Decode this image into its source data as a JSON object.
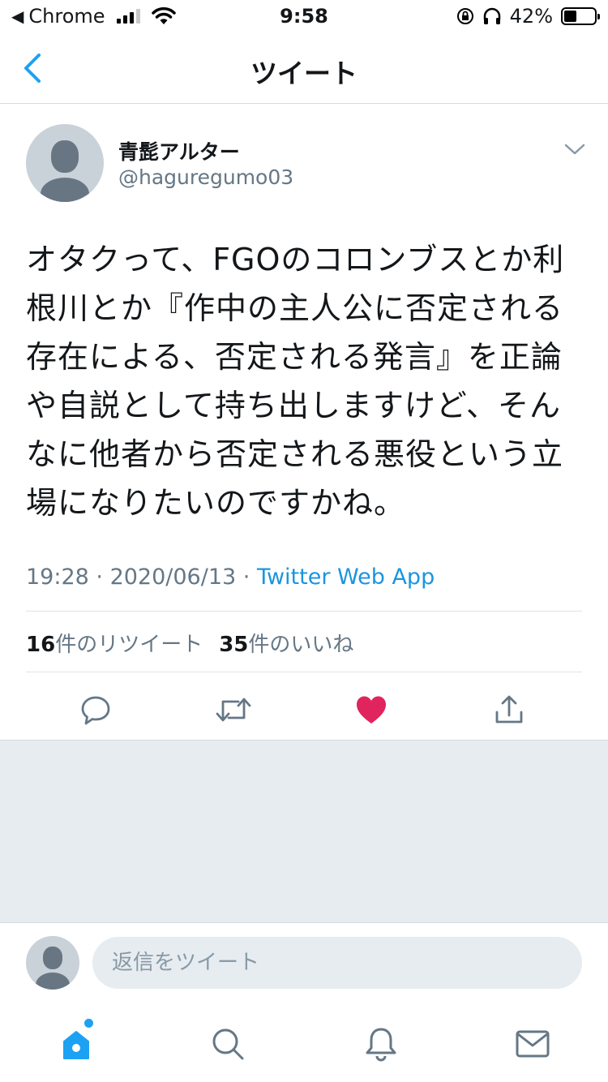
{
  "status_bar": {
    "back_app": "Chrome",
    "time": "9:58",
    "battery_percent": "42%",
    "battery_level": 0.42
  },
  "header": {
    "title": "ツイート"
  },
  "tweet": {
    "author_name": "青髭アルター",
    "author_handle": "@haguregumo03",
    "text": "オタクって、FGOのコロンブスとか利根川とか『作中の主人公に否定される存在による、否定される発言』を正論や自説として持ち出しますけど、そんなに他者から否定される悪役という立場になりたいのですかね。",
    "time": "19:28",
    "separator": " · ",
    "date": "2020/06/13",
    "source": "Twitter Web App",
    "retweet_count": "16",
    "retweet_label": "件のリツイート",
    "like_count": "35",
    "like_label": "件のいいね",
    "liked": true
  },
  "reply_bar": {
    "placeholder": "返信をツイート"
  },
  "colors": {
    "accent": "#1da1f2",
    "link": "#1b95e0",
    "like": "#e0245e",
    "muted": "#657786",
    "background_grey": "#e6ecf0"
  },
  "tab_bar": {
    "items": [
      "home-icon",
      "search-icon",
      "notifications-icon",
      "messages-icon"
    ],
    "active": "home-icon"
  }
}
